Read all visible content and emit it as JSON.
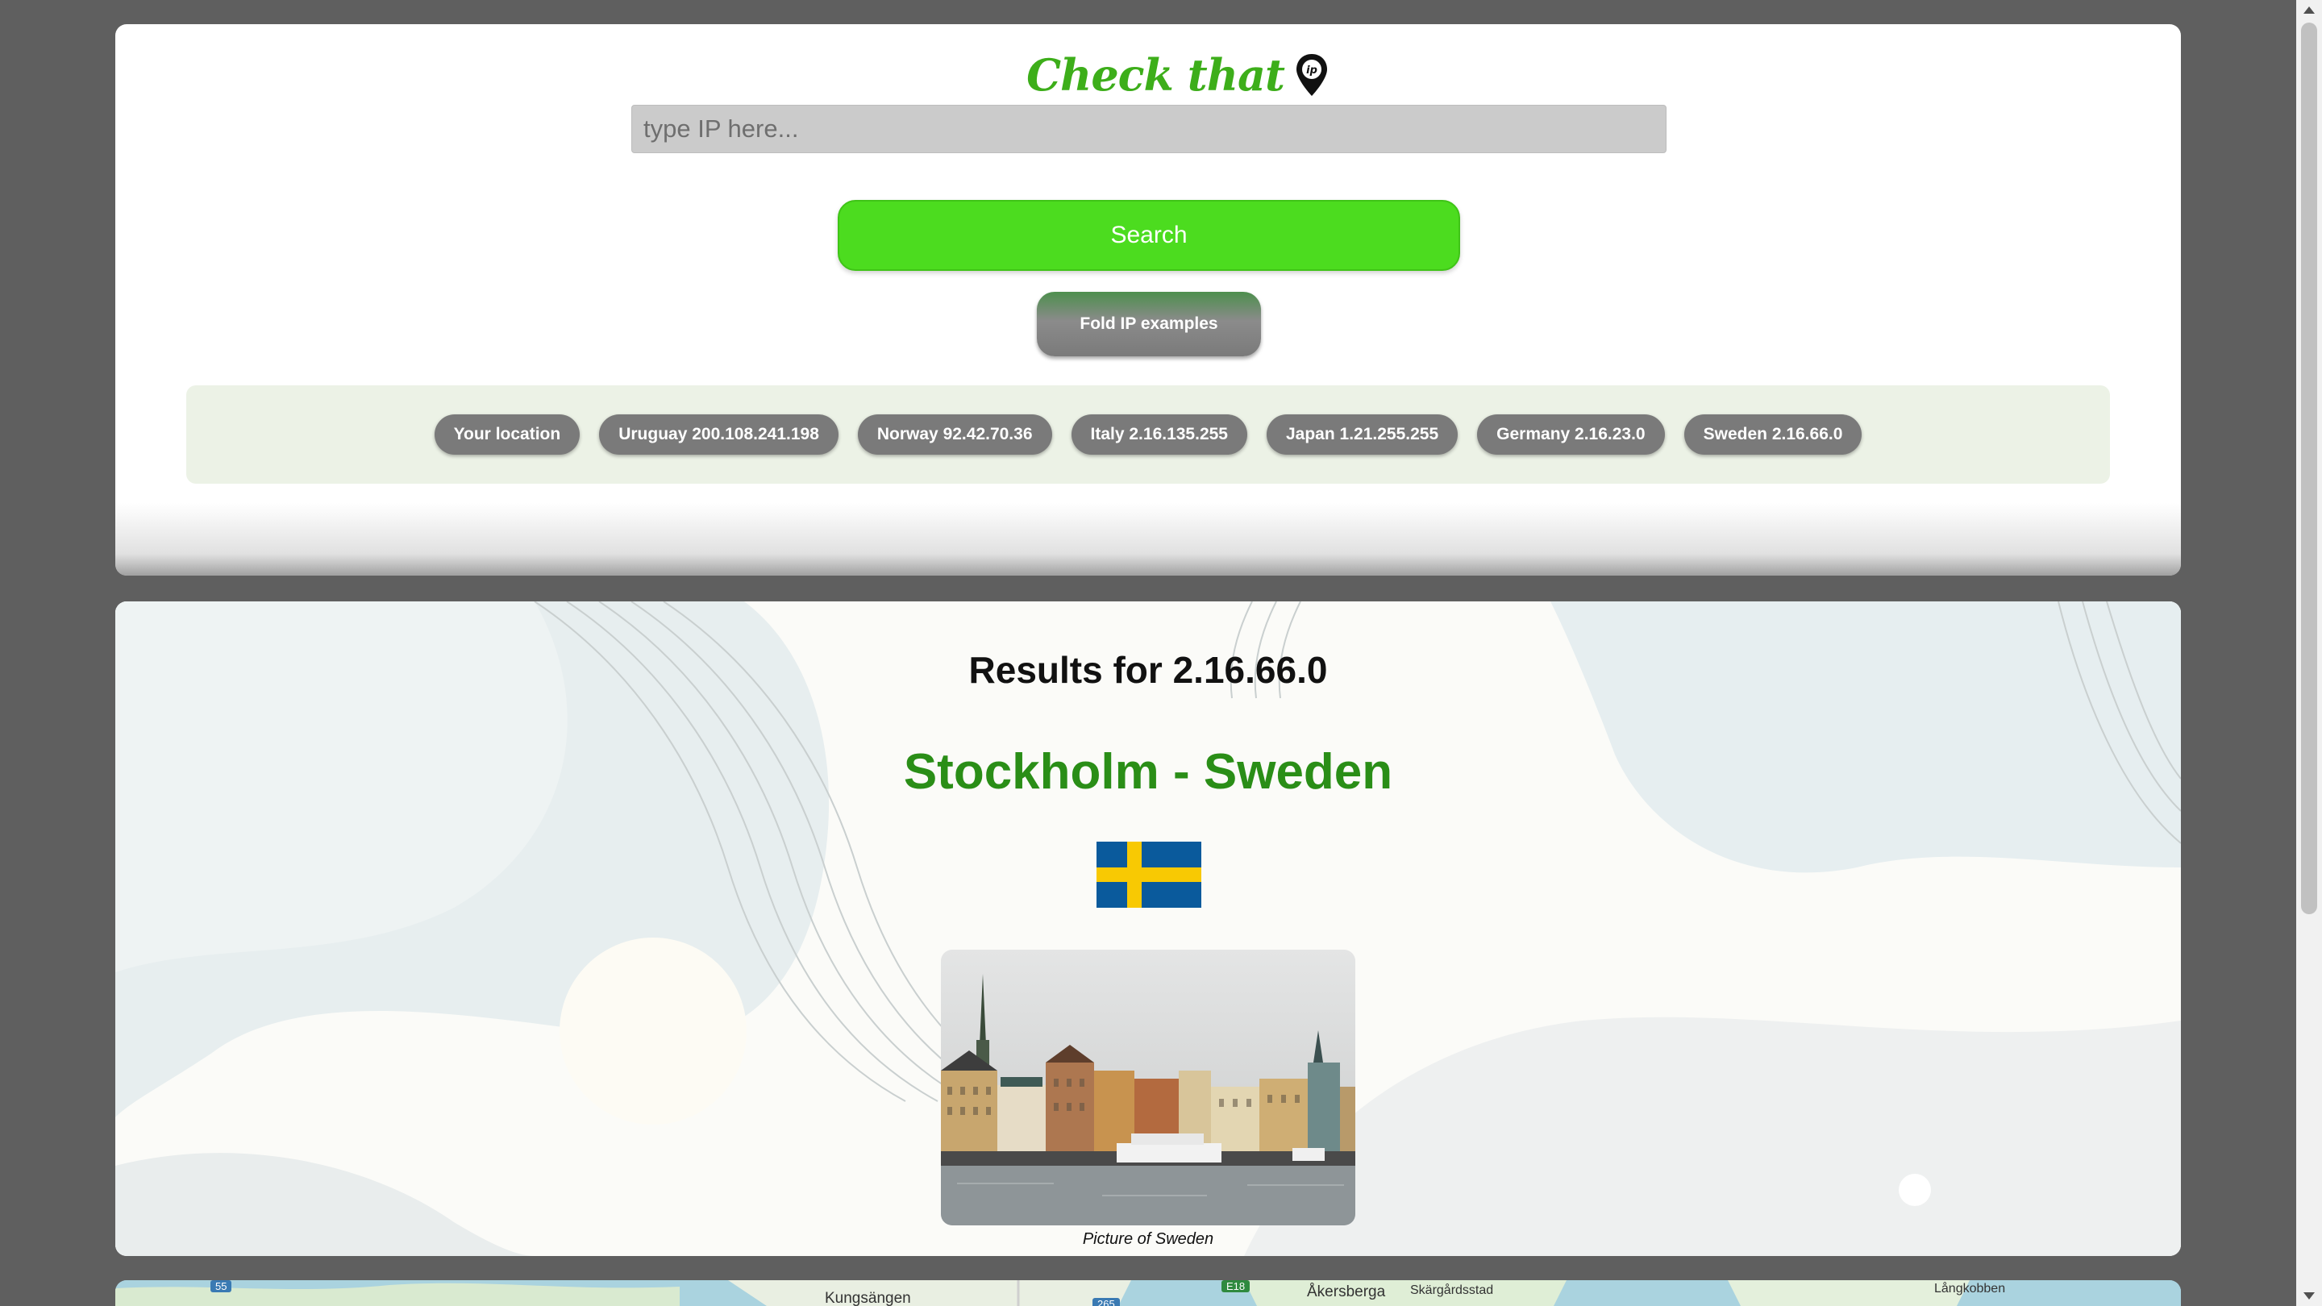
{
  "logo": {
    "text": "Check that",
    "pin_text": "ip"
  },
  "search": {
    "placeholder": "type IP here...",
    "value": ""
  },
  "buttons": {
    "search_label": "Search",
    "fold_label": "Fold IP examples"
  },
  "examples": [
    "Your location",
    "Uruguay 200.108.241.198",
    "Norway 92.42.70.36",
    "Italy 2.16.135.255",
    "Japan 1.21.255.255",
    "Germany 2.16.23.0",
    "Sweden 2.16.66.0"
  ],
  "results": {
    "title": "Results for 2.16.66.0",
    "location": "Stockholm - Sweden",
    "flag": "sweden-flag",
    "caption": "Picture of Sweden"
  },
  "map": {
    "labels": [
      "Kungsängen",
      "Åkersberga",
      "Skärgårdsstad",
      "Långkobben"
    ],
    "road_shields": [
      "55",
      "E18",
      "265"
    ]
  },
  "colors": {
    "brand_green": "#3dae1a",
    "search_button": "#4cdc1f",
    "location_text": "#2a8e17",
    "chip": "#7a7a7a",
    "background": "#5f5f5f"
  }
}
